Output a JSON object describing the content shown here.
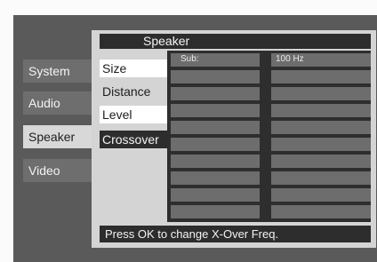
{
  "header": {
    "title": "Speaker"
  },
  "left_menu": {
    "items": [
      {
        "label": "System"
      },
      {
        "label": "Audio"
      },
      {
        "label": "Speaker"
      },
      {
        "label": "Video"
      }
    ],
    "selected": "Speaker"
  },
  "sub_menu": {
    "items": [
      {
        "label": "Size"
      },
      {
        "label": "Distance"
      },
      {
        "label": "Level"
      },
      {
        "label": "Crossover"
      }
    ],
    "selected": "Crossover"
  },
  "grid": {
    "rows": [
      {
        "channel": "Sub:",
        "value": "100 Hz"
      },
      {
        "channel": "",
        "value": ""
      },
      {
        "channel": "",
        "value": ""
      },
      {
        "channel": "",
        "value": ""
      },
      {
        "channel": "",
        "value": ""
      },
      {
        "channel": "",
        "value": ""
      },
      {
        "channel": "",
        "value": ""
      },
      {
        "channel": "",
        "value": ""
      },
      {
        "channel": "",
        "value": ""
      },
      {
        "channel": "",
        "value": ""
      }
    ]
  },
  "status": {
    "hint": "Press OK to change X-Over Freq."
  }
}
